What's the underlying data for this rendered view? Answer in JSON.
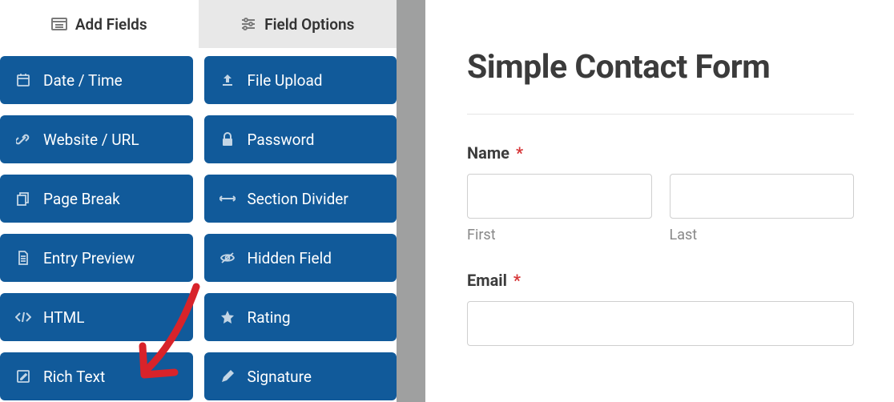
{
  "tabs": {
    "add_fields": "Add Fields",
    "field_options": "Field Options"
  },
  "fields": {
    "date_time": "Date / Time",
    "file_upload": "File Upload",
    "website_url": "Website / URL",
    "password": "Password",
    "page_break": "Page Break",
    "section_divider": "Section Divider",
    "entry_preview": "Entry Preview",
    "hidden_field": "Hidden Field",
    "html": "HTML",
    "rating": "Rating",
    "rich_text": "Rich Text",
    "signature": "Signature"
  },
  "preview": {
    "title": "Simple Contact Form",
    "name_label": "Name",
    "required": "*",
    "first_sublabel": "First",
    "last_sublabel": "Last",
    "email_label": "Email"
  }
}
